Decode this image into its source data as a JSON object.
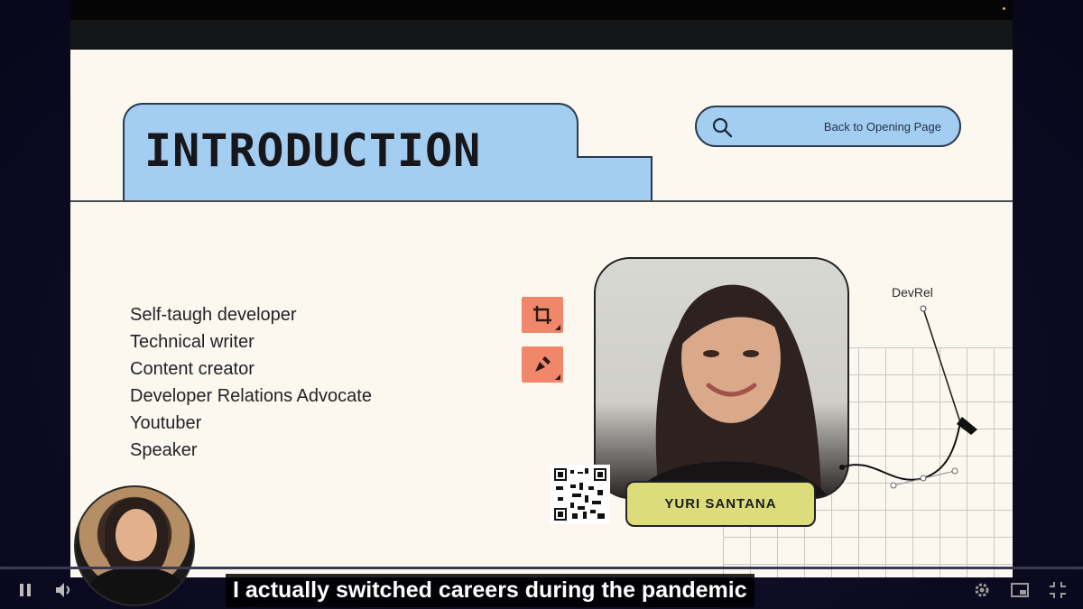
{
  "slide": {
    "title": "INTRODUCTION",
    "nav_button_label": "Back to Opening Page",
    "roles": [
      "Self-taugh developer",
      "Technical writer",
      "Content creator",
      "Developer Relations Advocate",
      "Youtuber",
      "Speaker"
    ],
    "name_tag": "YURI SANTANA",
    "diagram_label": "DevRel",
    "colors": {
      "background": "#fcf8ef",
      "title_tab": "#a4cdf2",
      "tool_button": "#f0866a",
      "name_tag": "#dcdc7a"
    }
  },
  "player": {
    "caption": "I actually switched careers during the pandemic",
    "icons": [
      "pause-icon",
      "volume-icon",
      "settings-icon",
      "miniplayer-icon",
      "exit-fullscreen-icon"
    ]
  }
}
